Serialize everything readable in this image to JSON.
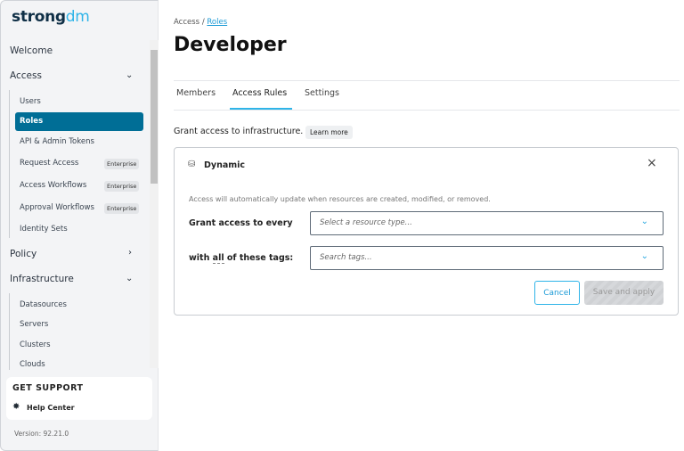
{
  "brand": {
    "logo_strong": "strong",
    "logo_dm": "dm"
  },
  "sidebar": {
    "welcome": "Welcome",
    "access": {
      "label": "Access",
      "items": [
        {
          "label": "Users"
        },
        {
          "label": "Roles"
        },
        {
          "label": "API & Admin Tokens"
        },
        {
          "label": "Request Access",
          "badge": "Enterprise"
        },
        {
          "label": "Access Workflows",
          "badge": "Enterprise"
        },
        {
          "label": "Approval Workflows",
          "badge": "Enterprise"
        },
        {
          "label": "Identity Sets"
        }
      ]
    },
    "policy": "Policy",
    "infrastructure": {
      "label": "Infrastructure",
      "items": [
        {
          "label": "Datasources"
        },
        {
          "label": "Servers"
        },
        {
          "label": "Clusters"
        },
        {
          "label": "Clouds"
        }
      ]
    },
    "support": {
      "title": "GET SUPPORT",
      "help": "Help Center"
    },
    "version": "Version: 92.21.0",
    "active_color": "#006e96"
  },
  "main": {
    "breadcrumb": {
      "parent": "Access",
      "sep": "/",
      "current": "Roles"
    },
    "title": "Developer",
    "tabs": [
      {
        "label": "Members"
      },
      {
        "label": "Access Rules",
        "active": true
      },
      {
        "label": "Settings"
      }
    ],
    "intro": "Grant access to infrastructure.",
    "learn_more": "Learn more",
    "card": {
      "title": "Dynamic",
      "description": "Access will automatically update when resources are created, modified, or removed.",
      "grant_label": "Grant access to every",
      "resource_placeholder": "Select a resource type...",
      "tags_label_pre": "with ",
      "tags_label_all": "all",
      "tags_label_post": " of these tags:",
      "tags_placeholder": "Search tags...",
      "cancel": "Cancel",
      "save": "Save and apply"
    }
  }
}
